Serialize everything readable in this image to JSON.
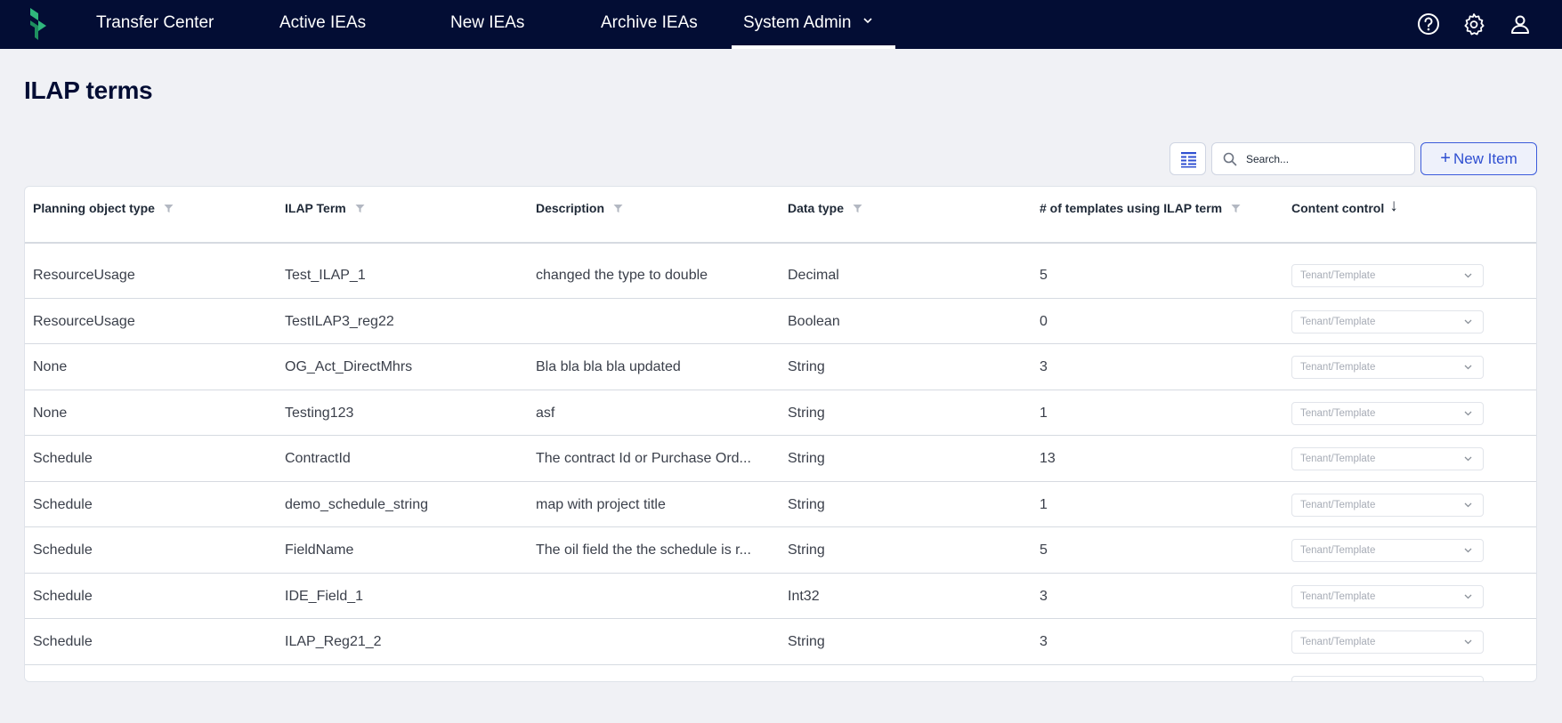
{
  "nav": {
    "items": [
      {
        "label": "Transfer Center"
      },
      {
        "label": "Active IEAs"
      },
      {
        "label": "New IEAs"
      },
      {
        "label": "Archive IEAs"
      },
      {
        "label": "System Admin"
      }
    ],
    "active": "System Admin",
    "right_icons": [
      "help-icon",
      "gear-icon",
      "user-icon"
    ],
    "background": "#030d34"
  },
  "page": {
    "title": "ILAP terms"
  },
  "toolbar": {
    "view_icon": "column-view-icon",
    "search_placeholder": "Search...",
    "search_value": "",
    "new_item_label": "New Item",
    "new_item_icon": "plus-icon",
    "accent": "#2f4fd1"
  },
  "table": {
    "columns": [
      {
        "label": "Planning object type",
        "filter": true
      },
      {
        "label": "ILAP Term",
        "filter": true
      },
      {
        "label": "Description",
        "filter": true
      },
      {
        "label": "Data type",
        "filter": true
      },
      {
        "label": "# of templates using ILAP term",
        "filter": true
      },
      {
        "label": "Content control",
        "sort": "descending"
      }
    ],
    "rows": [
      {
        "type": "ResourceUsage",
        "term": "Test_ILAP_1",
        "description": "changed the type to double",
        "data_type": "Decimal",
        "templates": "5",
        "content_control": "Tenant/Template"
      },
      {
        "type": "ResourceUsage",
        "term": "TestILAP3_reg22",
        "description": "",
        "data_type": "Boolean",
        "templates": "0",
        "content_control": "Tenant/Template"
      },
      {
        "type": "None",
        "term": "OG_Act_DirectMhrs",
        "description": "Bla bla bla bla updated",
        "data_type": "String",
        "templates": "3",
        "content_control": "Tenant/Template"
      },
      {
        "type": "None",
        "term": "Testing123",
        "description": "asf",
        "data_type": "String",
        "templates": "1",
        "content_control": "Tenant/Template"
      },
      {
        "type": "Schedule",
        "term": "ContractId",
        "description": "The contract Id or Purchase Ord...",
        "data_type": "String",
        "templates": "13",
        "content_control": "Tenant/Template"
      },
      {
        "type": "Schedule",
        "term": "demo_schedule_string",
        "description": "map with project title",
        "data_type": "String",
        "templates": "1",
        "content_control": "Tenant/Template"
      },
      {
        "type": "Schedule",
        "term": "FieldName",
        "description": "The oil field the the schedule is r...",
        "data_type": "String",
        "templates": "5",
        "content_control": "Tenant/Template"
      },
      {
        "type": "Schedule",
        "term": "IDE_Field_1",
        "description": "",
        "data_type": "Int32",
        "templates": "3",
        "content_control": "Tenant/Template"
      },
      {
        "type": "Schedule",
        "term": "ILAP_Reg21_2",
        "description": "",
        "data_type": "String",
        "templates": "3",
        "content_control": "Tenant/Template"
      }
    ]
  }
}
